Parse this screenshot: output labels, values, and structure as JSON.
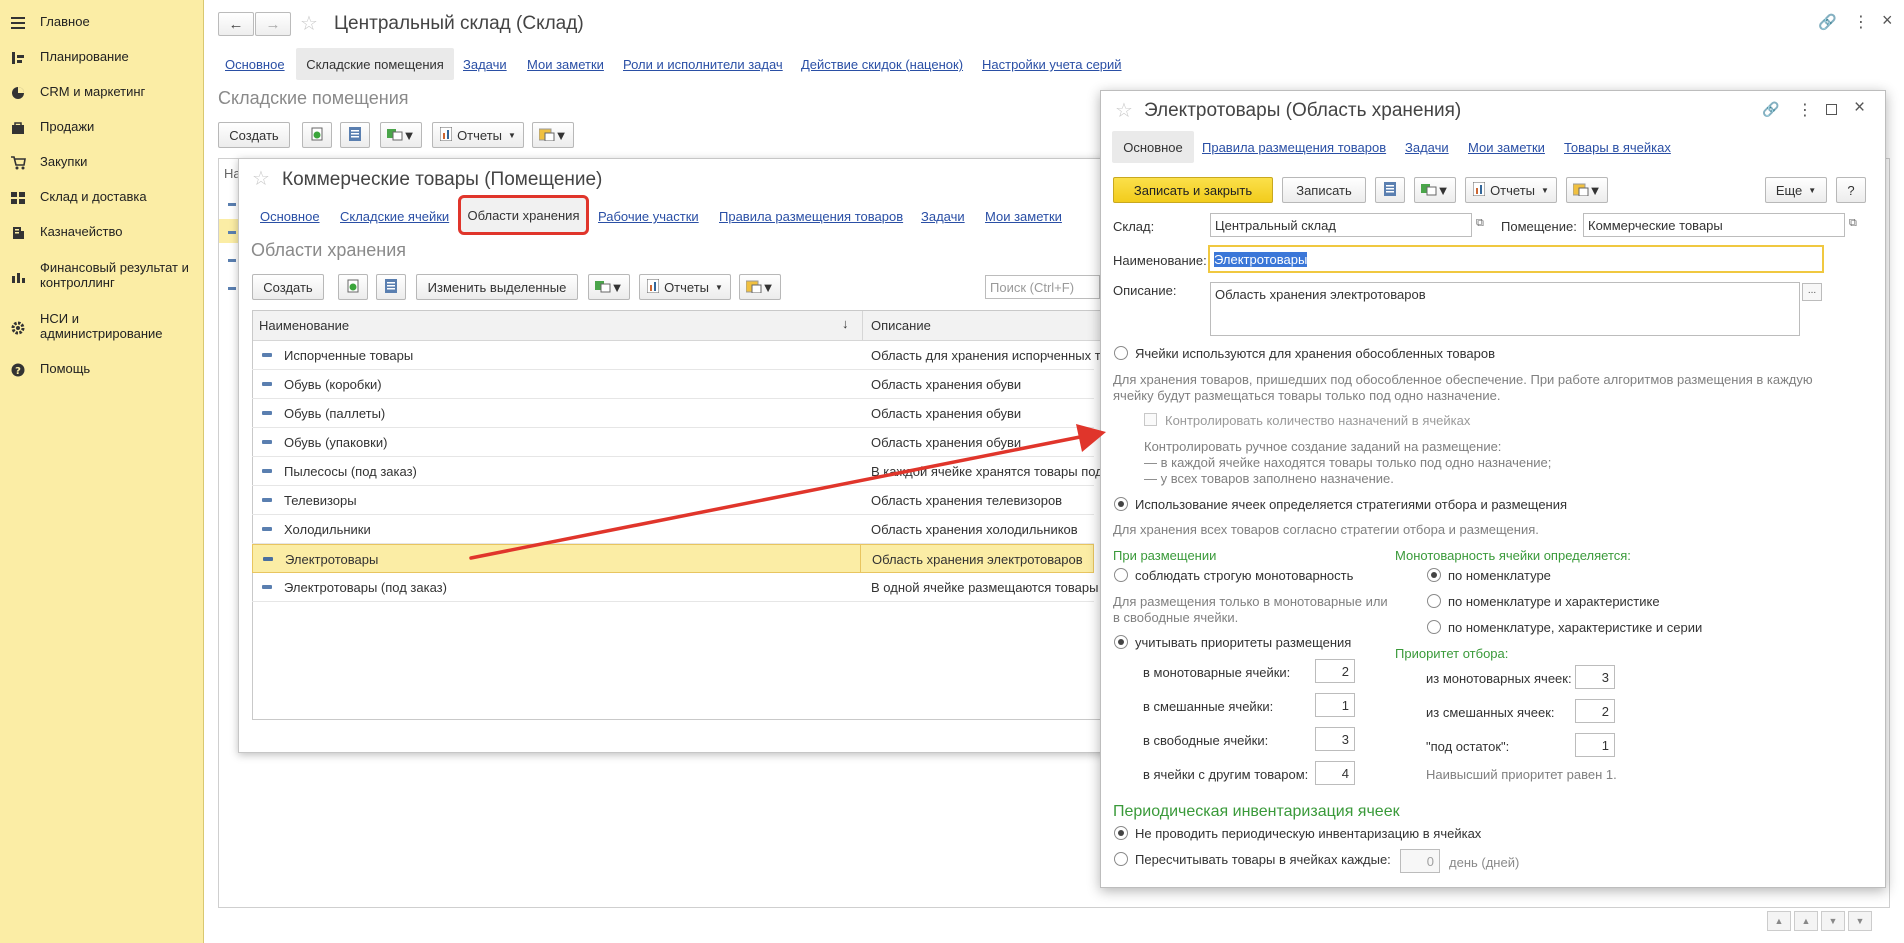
{
  "sidebar": {
    "items": [
      {
        "label": "Главное",
        "icon": "menu-icon"
      },
      {
        "label": "Планирование",
        "icon": "planning-icon"
      },
      {
        "label": "CRM и маркетинг",
        "icon": "crm-icon"
      },
      {
        "label": "Продажи",
        "icon": "sales-bag-icon"
      },
      {
        "label": "Закупки",
        "icon": "cart-icon"
      },
      {
        "label": "Склад и доставка",
        "icon": "warehouse-grid-icon"
      },
      {
        "label": "Казначейство",
        "icon": "treasury-icon"
      },
      {
        "label": "Финансовый результат и контроллинг",
        "icon": "bar-chart-icon"
      },
      {
        "label": "НСИ и администрирование",
        "icon": "gear-icon"
      },
      {
        "label": "Помощь",
        "icon": "help-icon"
      }
    ]
  },
  "main": {
    "title": "Центральный склад (Склад)",
    "tabs": [
      "Основное",
      "Складские помещения",
      "Задачи",
      "Мои заметки",
      "Роли и исполнители задач",
      "Действие скидок (наценок)",
      "Настройки учета серий"
    ],
    "section_title": "Складские помещения",
    "create_label": "Создать",
    "reports_label": "Отчеты",
    "col_prefix": "На"
  },
  "room_window": {
    "title": "Коммерческие товары (Помещение)",
    "tabs": [
      "Основное",
      "Складские ячейки",
      "Области хранения",
      "Рабочие участки",
      "Правила размещения товаров",
      "Задачи",
      "Мои заметки"
    ],
    "section_title": "Области хранения",
    "create_label": "Создать",
    "edit_selected_label": "Изменить выделенные",
    "reports_label": "Отчеты",
    "search_placeholder": "Поиск (Ctrl+F)",
    "columns": [
      "Наименование",
      "Описание"
    ],
    "rows": [
      {
        "name": "Испорченные товары",
        "desc": "Область для хранения испорченных тов"
      },
      {
        "name": "Обувь (коробки)",
        "desc": "Область хранения обуви"
      },
      {
        "name": "Обувь (паллеты)",
        "desc": "Область хранения обуви"
      },
      {
        "name": "Обувь (упаковки)",
        "desc": "Область хранения обуви"
      },
      {
        "name": "Пылесосы (под заказ)",
        "desc": "В каждой ячейке хранятся товары под"
      },
      {
        "name": "Телевизоры",
        "desc": "Область хранения телевизоров"
      },
      {
        "name": "Холодильники",
        "desc": "Область хранения холодильников"
      },
      {
        "name": "Электротовары",
        "desc": "Область хранения электротоваров"
      },
      {
        "name": "Электротовары (под заказ)",
        "desc": "В одной ячейке размещаются товары"
      }
    ],
    "selected_row": 7
  },
  "area_window": {
    "title": "Электротовары (Область хранения)",
    "tabs": [
      "Основное",
      "Правила размещения товаров",
      "Задачи",
      "Мои заметки",
      "Товары в ячейках"
    ],
    "save_close_label": "Записать и закрыть",
    "save_label": "Записать",
    "reports_label": "Отчеты",
    "more_label": "Еще",
    "help_label": "?",
    "warehouse_label": "Склад:",
    "warehouse_value": "Центральный склад",
    "room_label": "Помещение:",
    "room_value": "Коммерческие товары",
    "name_label": "Наименование:",
    "name_value": "Электротовары",
    "desc_label": "Описание:",
    "desc_value": "Область хранения электротоваров",
    "ellipsis": "...",
    "opt_isolated": "Ячейки используются для хранения обособленных товаров",
    "hint_isolated_1": "Для хранения товаров, пришедших под обособленное обеспечение. При работе алгоритмов размещения в каждую",
    "hint_isolated_2": "ячейку будут размещаться товары только под одно назначение.",
    "control_count_label": "Контролировать количество назначений в ячейках",
    "hint_control_1": "Контролировать ручное создание заданий на размещение:",
    "hint_control_2": "— в каждой ячейке находятся товары только под одно назначение;",
    "hint_control_3": "— у всех товаров заполнено назначение.",
    "opt_strategy": "Использование ячеек определяется стратегиями отбора и размещения",
    "hint_strategy": "Для хранения всех товаров согласно стратегии отбора и размещения.",
    "placement_title": "При размещении",
    "opt_strict": "соблюдать строгую монотоварность",
    "hint_strict_1": "Для размещения только в монотоварные или",
    "hint_strict_2": "в свободные ячейки.",
    "opt_priorities": "учитывать приоритеты размещения",
    "prio_mono_label": "в монотоварные ячейки:",
    "prio_mono": "2",
    "prio_mixed_label": "в смешанные ячейки:",
    "prio_mixed": "1",
    "prio_free_label": "в свободные ячейки:",
    "prio_free": "3",
    "prio_other_label": "в ячейки с другим товаром:",
    "prio_other": "4",
    "mono_title": "Монотоварность ячейки определяется:",
    "mono_opt_1": "по номенклатуре",
    "mono_opt_2": "по номенклатуре и характеристике",
    "mono_opt_3": "по номенклатуре, характеристике и серии",
    "pick_title": "Приоритет отбора:",
    "pick_mono_label": "из монотоварных ячеек:",
    "pick_mono": "3",
    "pick_mixed_label": "из смешанных ячеек:",
    "pick_mixed": "2",
    "pick_rest_label": "\"под остаток\":",
    "pick_rest": "1",
    "pick_hint": "Наивысший приоритет равен 1.",
    "inv_title": "Периодическая инвентаризация ячеек",
    "inv_opt_1": "Не проводить периодическую инвентаризацию в ячейках",
    "inv_opt_2": "Пересчитывать товары в ячейках каждые:",
    "inv_days": "0",
    "inv_unit": "день (дней)"
  },
  "colors": {
    "sidebar_bg": "#FBEDA5",
    "save_button": "#F7D629",
    "arrow": "#E0352B",
    "highlight_box": "#E0352B",
    "link": "#2A4FA5",
    "green_heading": "#3A9A3A"
  }
}
